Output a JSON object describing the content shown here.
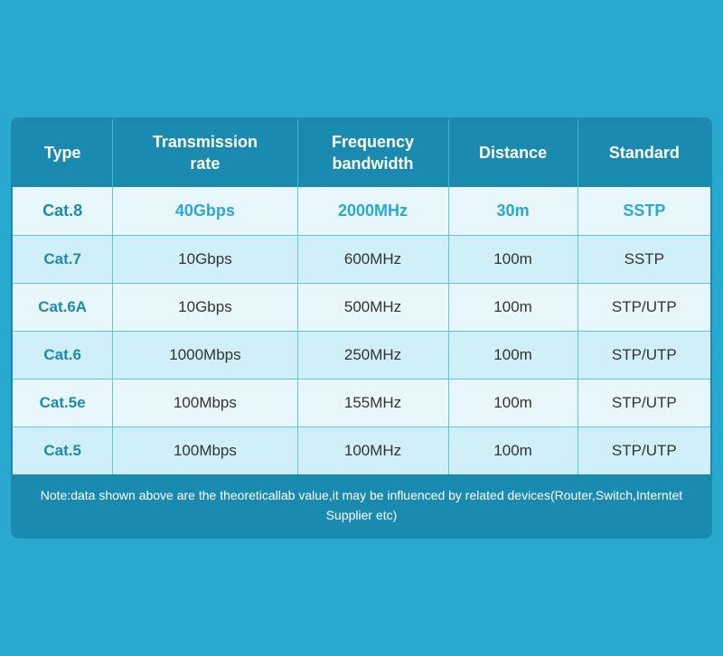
{
  "table": {
    "headers": [
      {
        "id": "type",
        "label": "Type"
      },
      {
        "id": "transmission",
        "label": "Transmission\nrate"
      },
      {
        "id": "frequency",
        "label": "Frequency\nbandwidth"
      },
      {
        "id": "distance",
        "label": "Distance"
      },
      {
        "id": "standard",
        "label": "Standard"
      }
    ],
    "rows": [
      {
        "type": "Cat.8",
        "transmission": "40Gbps",
        "frequency": "2000MHz",
        "distance": "30m",
        "standard": "SSTP"
      },
      {
        "type": "Cat.7",
        "transmission": "10Gbps",
        "frequency": "600MHz",
        "distance": "100m",
        "standard": "SSTP"
      },
      {
        "type": "Cat.6A",
        "transmission": "10Gbps",
        "frequency": "500MHz",
        "distance": "100m",
        "standard": "STP/UTP"
      },
      {
        "type": "Cat.6",
        "transmission": "1000Mbps",
        "frequency": "250MHz",
        "distance": "100m",
        "standard": "STP/UTP"
      },
      {
        "type": "Cat.5e",
        "transmission": "100Mbps",
        "frequency": "155MHz",
        "distance": "100m",
        "standard": "STP/UTP"
      },
      {
        "type": "Cat.5",
        "transmission": "100Mbps",
        "frequency": "100MHz",
        "distance": "100m",
        "standard": "STP/UTP"
      }
    ],
    "footer_note": "Note:data shown above are the theoreticallab value,it may be influenced by related devices(Router,Switch,Interntet Supplier etc)"
  }
}
